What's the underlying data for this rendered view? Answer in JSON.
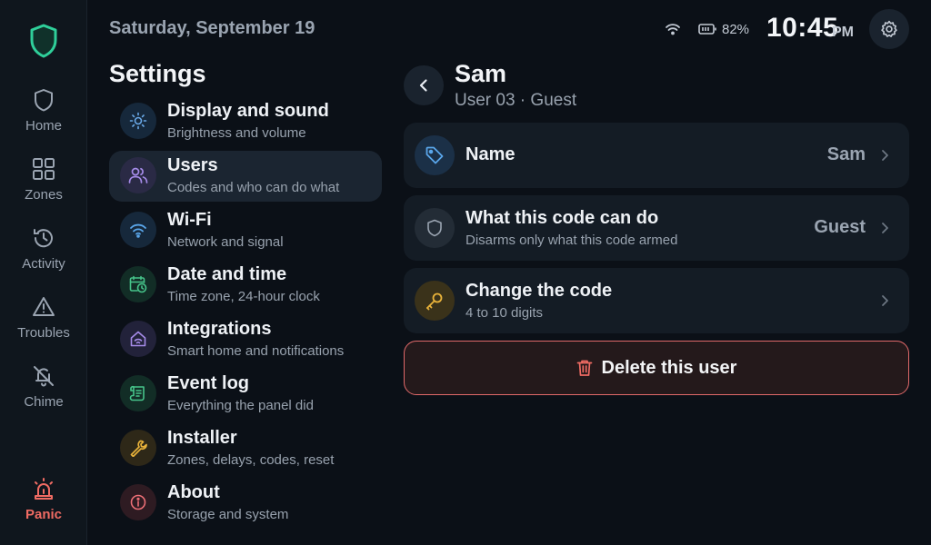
{
  "rail": {
    "items": [
      {
        "label": "Home",
        "icon": "shield-icon"
      },
      {
        "label": "Zones",
        "icon": "grid-icon"
      },
      {
        "label": "Activity",
        "icon": "history-icon"
      },
      {
        "label": "Troubles",
        "icon": "warning-icon"
      },
      {
        "label": "Chime",
        "icon": "bell-off-icon"
      }
    ],
    "panic": {
      "label": "Panic",
      "icon": "siren-icon"
    }
  },
  "header": {
    "date": "Saturday, September 19",
    "battery": "82%",
    "time": "10:45",
    "ampm": "PM"
  },
  "settings": {
    "title": "Settings",
    "items": [
      {
        "title": "Display and sound",
        "subtitle": "Brightness and volume",
        "icon": "sun-icon",
        "color": "#6aa9e8"
      },
      {
        "title": "Users",
        "subtitle": "Codes and who can do what",
        "icon": "users-icon",
        "color": "#a58be8",
        "active": true
      },
      {
        "title": "Wi-Fi",
        "subtitle": "Network and signal",
        "icon": "wifi-icon",
        "color": "#5aa6ea"
      },
      {
        "title": "Date and time",
        "subtitle": "Time zone, 24-hour clock",
        "icon": "calendar-clock-icon",
        "color": "#46c48a"
      },
      {
        "title": "Integrations",
        "subtitle": "Smart home and notifications",
        "icon": "smart-home-icon",
        "color": "#a58be8"
      },
      {
        "title": "Event log",
        "subtitle": "Everything the panel did",
        "icon": "scroll-icon",
        "color": "#46c48a"
      },
      {
        "title": "Installer",
        "subtitle": "Zones, delays, codes, reset",
        "icon": "wrench-icon",
        "color": "#e8b23a"
      },
      {
        "title": "About",
        "subtitle": "Storage and system",
        "icon": "info-icon",
        "color": "#ec6f76"
      }
    ]
  },
  "detail": {
    "name": "Sam",
    "subtitle": "User 03 · Guest",
    "rows": [
      {
        "title": "Name",
        "subtitle": "",
        "value": "Sam",
        "icon": "tag-icon"
      },
      {
        "title": "What this code can do",
        "subtitle": "Disarms only what this code armed",
        "value": "Guest",
        "icon": "shield-icon"
      },
      {
        "title": "Change the code",
        "subtitle": "4 to 10 digits",
        "value": "",
        "icon": "key-icon"
      }
    ],
    "delete_label": "Delete this user"
  },
  "colors": {
    "background": "#0b1017",
    "accent_green": "#2fcf9a",
    "danger": "#ef6b63"
  }
}
